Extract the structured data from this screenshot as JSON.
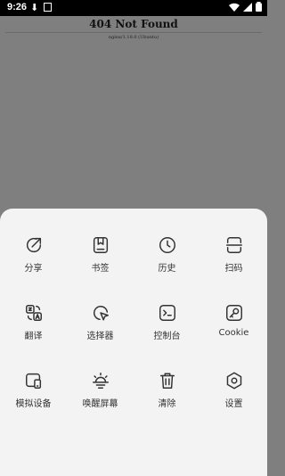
{
  "status_bar": {
    "time": "9:26"
  },
  "webpage": {
    "heading": "404 Not Found",
    "server": "nginx/1.18.0 (Ubuntu)"
  },
  "menu": {
    "items": [
      {
        "label": "分享",
        "icon": "share-icon"
      },
      {
        "label": "书签",
        "icon": "bookmark-icon"
      },
      {
        "label": "历史",
        "icon": "history-icon"
      },
      {
        "label": "扫码",
        "icon": "scan-icon"
      },
      {
        "label": "翻译",
        "icon": "translate-icon"
      },
      {
        "label": "选择器",
        "icon": "selector-icon"
      },
      {
        "label": "控制台",
        "icon": "console-icon"
      },
      {
        "label": "Cookie",
        "icon": "cookie-icon"
      },
      {
        "label": "模拟设备",
        "icon": "device-icon"
      },
      {
        "label": "唤醒屏幕",
        "icon": "wake-screen-icon"
      },
      {
        "label": "清除",
        "icon": "trash-icon"
      },
      {
        "label": "设置",
        "icon": "settings-icon"
      }
    ]
  }
}
